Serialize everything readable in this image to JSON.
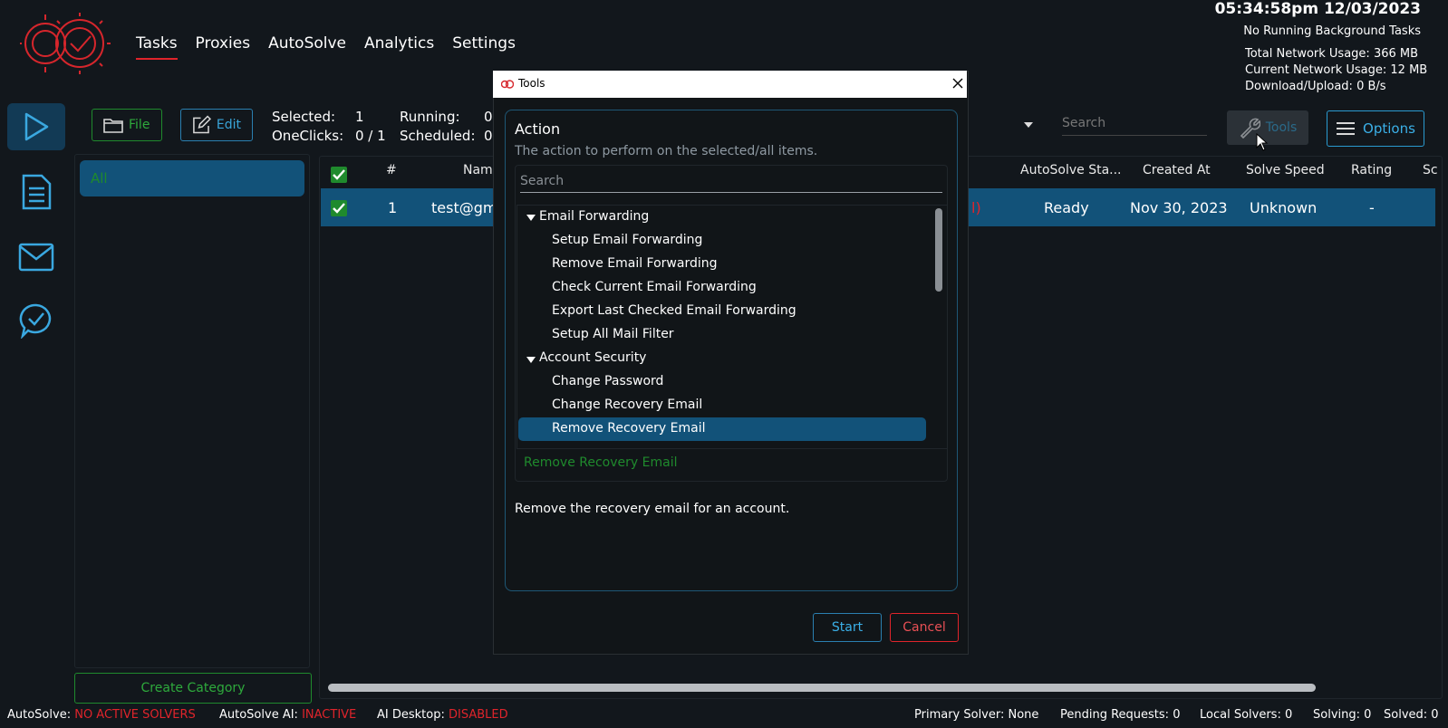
{
  "header": {
    "nav": [
      "Tasks",
      "Proxies",
      "AutoSolve",
      "Analytics",
      "Settings"
    ],
    "active_nav": "Tasks",
    "clock": "05:34:58pm 12/03/2023",
    "background_tasks": "No Running Background Tasks",
    "total_network_label": "Total Network Usage:",
    "total_network_value": "366 MB",
    "current_network_label": "Current Network Usage:",
    "current_network_value": "12 MB",
    "download_upload_label": "Download/Upload:",
    "download_upload_value": "0 B/s"
  },
  "rail": {
    "items": [
      "play-icon",
      "document-icon",
      "mail-icon",
      "chat-check-icon"
    ],
    "active": "play-icon"
  },
  "toolbar": {
    "file_label": "File",
    "edit_label": "Edit",
    "selected_label": "Selected:",
    "selected_value": "1",
    "running_label": "Running:",
    "running_value": "0",
    "oneclicks_label": "OneClicks:",
    "oneclicks_value": "0 / 1",
    "scheduled_label": "Scheduled:",
    "scheduled_value": "0",
    "search_placeholder": "Search",
    "tools_label": "Tools",
    "options_label": "Options"
  },
  "categories": {
    "items": [
      "All"
    ],
    "create_label": "Create Category"
  },
  "grid": {
    "columns": [
      "#",
      "Name",
      "AutoSolve Sta...",
      "Created At",
      "Solve Speed",
      "Rating",
      "Sc"
    ],
    "rows": [
      {
        "index": "1",
        "name": "test@gm",
        "partial": "l)",
        "autosolve": "Ready",
        "created": "Nov 30, 2023",
        "speed": "Unknown",
        "rating": "-"
      }
    ]
  },
  "status_bar": {
    "autosolve_label": "AutoSolve:",
    "autosolve_value": "NO ACTIVE SOLVERS",
    "ai_label": "AutoSolve AI:",
    "ai_value": "INACTIVE",
    "desktop_label": "AI Desktop:",
    "desktop_value": "DISABLED",
    "primary_solver": "Primary Solver: None",
    "pending": "Pending Requests: 0",
    "local": "Local Solvers: 0",
    "solving": "Solving: 0",
    "solved": "Solved: 0"
  },
  "modal": {
    "title": "Tools",
    "action_label": "Action",
    "action_desc": "The action to perform on the selected/all items.",
    "search_placeholder": "Search",
    "groups": [
      {
        "label": "Email Forwarding",
        "items": [
          "Setup Email Forwarding",
          "Remove Email Forwarding",
          "Check Current Email Forwarding",
          "Export Last Checked Email Forwarding",
          "Setup All Mail Filter"
        ]
      },
      {
        "label": "Account Security",
        "items": [
          "Change Password",
          "Change Recovery Email",
          "Remove Recovery Email"
        ]
      }
    ],
    "selected_item": "Remove Recovery Email",
    "selected_action": "Remove Recovery Email",
    "detail": "Remove the recovery email for an account.",
    "start_label": "Start",
    "cancel_label": "Cancel"
  },
  "colors": {
    "accent_blue": "#125279",
    "accent_green": "#1f8a2d",
    "accent_red": "#e0242b",
    "background": "#12171c"
  }
}
